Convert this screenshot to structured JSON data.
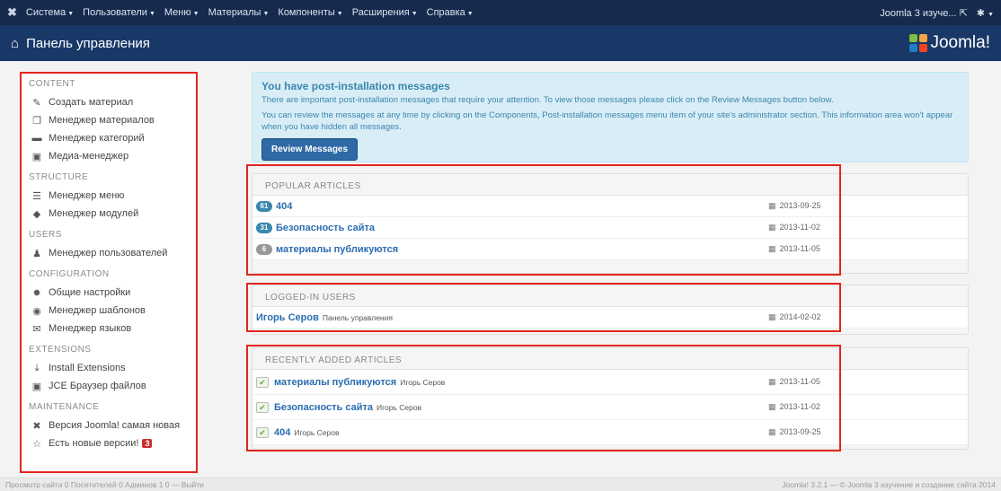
{
  "topnav": {
    "menu": [
      "Система",
      "Пользователи",
      "Меню",
      "Материалы",
      "Компоненты",
      "Расширения",
      "Справка"
    ],
    "site_link": "Joomla 3 изуче...",
    "site_icon": "external-link-icon",
    "settings_icon": "gear-icon"
  },
  "header": {
    "title": "Панель управления",
    "logo_text": "Joomla!",
    "home_icon": "home-icon"
  },
  "sidebar": {
    "sections": [
      {
        "title": "CONTENT",
        "items": [
          {
            "label": "Создать материал",
            "icon": "pencil-icon"
          },
          {
            "label": "Менеджер материалов",
            "icon": "stack-icon"
          },
          {
            "label": "Менеджер категорий",
            "icon": "folder-icon"
          },
          {
            "label": "Медиа-менеджер",
            "icon": "image-icon"
          }
        ]
      },
      {
        "title": "STRUCTURE",
        "items": [
          {
            "label": "Менеджер меню",
            "icon": "list-icon"
          },
          {
            "label": "Менеджер модулей",
            "icon": "cube-icon"
          }
        ]
      },
      {
        "title": "USERS",
        "items": [
          {
            "label": "Менеджер пользователей",
            "icon": "users-icon"
          }
        ]
      },
      {
        "title": "CONFIGURATION",
        "items": [
          {
            "label": "Общие настройки",
            "icon": "cog-icon"
          },
          {
            "label": "Менеджер шаблонов",
            "icon": "eye-icon"
          },
          {
            "label": "Менеджер языков",
            "icon": "comments-icon"
          }
        ]
      },
      {
        "title": "EXTENSIONS",
        "items": [
          {
            "label": "Install Extensions",
            "icon": "download-icon"
          },
          {
            "label": "JCE Браузер файлов",
            "icon": "picture-icon"
          }
        ]
      },
      {
        "title": "MAINTENANCE",
        "items": [
          {
            "label": "Версия Joomla! самая новая",
            "icon": "joomla-icon"
          },
          {
            "label": "Есть новые версии!",
            "icon": "star-icon",
            "badge": "3"
          }
        ]
      }
    ]
  },
  "alert": {
    "title": "You have post-installation messages",
    "line1": "There are important post-installation messages that require your attention. To view those messages please click on the Review Messages button below.",
    "line2": "You can review the messages at any time by clicking on the Components, Post-installation messages menu item of your site's administrator section. This information area won't appear when you have hidden all messages.",
    "button": "Review Messages"
  },
  "popular": {
    "title": "POPULAR ARTICLES",
    "rows": [
      {
        "count": "61",
        "title": "404",
        "date": "2013-09-25",
        "grey": false
      },
      {
        "count": "31",
        "title": "Безопасность сайта",
        "date": "2013-11-02",
        "grey": false
      },
      {
        "count": "6",
        "title": "материалы публикуются",
        "date": "2013-11-05",
        "grey": true
      }
    ]
  },
  "logged": {
    "title": "LOGGED-IN USERS",
    "rows": [
      {
        "name": "Игорь Серов",
        "where": "Панель управления",
        "date": "2014-02-02"
      }
    ]
  },
  "recent": {
    "title": "RECENTLY ADDED ARTICLES",
    "rows": [
      {
        "title": "материалы публикуются",
        "author": "Игорь Серов",
        "date": "2013-11-05"
      },
      {
        "title": "Безопасность сайта",
        "author": "Игорь Серов",
        "date": "2013-11-02"
      },
      {
        "title": "404",
        "author": "Игорь Серов",
        "date": "2013-09-25"
      }
    ]
  },
  "footer": {
    "left": "Просмотр сайта   0 Посетителей   0 Админов   1   0 — Выйти",
    "right": "Joomla! 3.2.1 — © Joomla 3 изучение и создание сайта 2014"
  },
  "colors": {
    "navbar": "#152a4d",
    "header": "#1a3867",
    "highlight": "#e4251f",
    "link": "#2a6db1"
  }
}
